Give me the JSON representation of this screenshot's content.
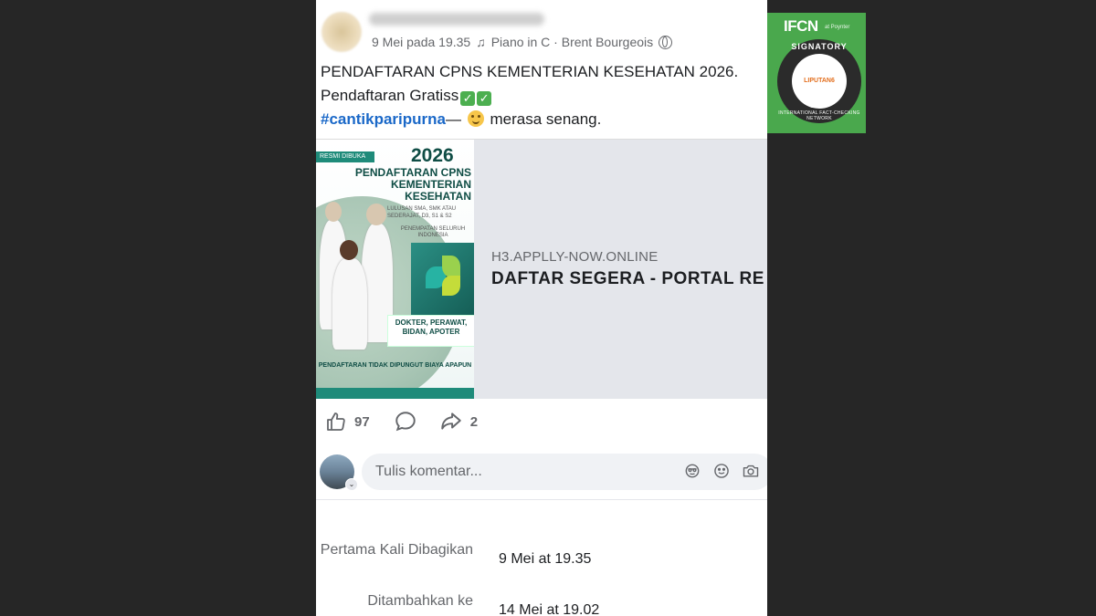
{
  "post": {
    "date": "9 Mei pada 19.35",
    "music_note": "♫",
    "music": "Piano in C · Brent Bourgeois",
    "privacy_icon": "globe-icon",
    "text_line1": "PENDAFTARAN CPNS KEMENTERIAN KESEHATAN 2026.",
    "text_line2": "Pendaftaran Gratiss",
    "hashtag": "#cantikparipurna",
    "feeling": "— ",
    "feeling_text": " merasa senang."
  },
  "link_preview": {
    "image": {
      "badge": "RESMI DIBUKA",
      "year": "2026",
      "title": "PENDAFTARAN CPNS KEMENTERIAN KESEHATAN",
      "subtitle": "LULUSAN SMA, SMK ATAU SEDERAJAT, D3, S1 & S2",
      "placement": "PENEMPATAN SELURUH INDONESIA",
      "roles": "DOKTER, PERAWAT, BIDAN, APOTER",
      "footer": "PENDAFTARAN TIDAK DIPUNGUT BIAYA APAPUN"
    },
    "domain": "H3.APPLLY-NOW.ONLINE",
    "title": "DAFTAR SEGERA - PORTAL RE"
  },
  "actions": {
    "like_count": "97",
    "share_count": "2"
  },
  "comment": {
    "placeholder": "Tulis komentar..."
  },
  "info": {
    "first_shared_label": "Pertama Kali Dibagikan",
    "first_shared_value": "9 Mei at 19.35",
    "added_label": "Ditambahkan ke",
    "added_value": "14 Mei at 19.02"
  },
  "ifcn_badge": {
    "logo": "IFCN",
    "poynter": "at Poynter",
    "seal_top": "SIGNATORY",
    "seal_bottom": "INTERNATIONAL FACT-CHECKING NETWORK",
    "brand": "LIPUTAN6",
    "color": "#4aa84d"
  }
}
